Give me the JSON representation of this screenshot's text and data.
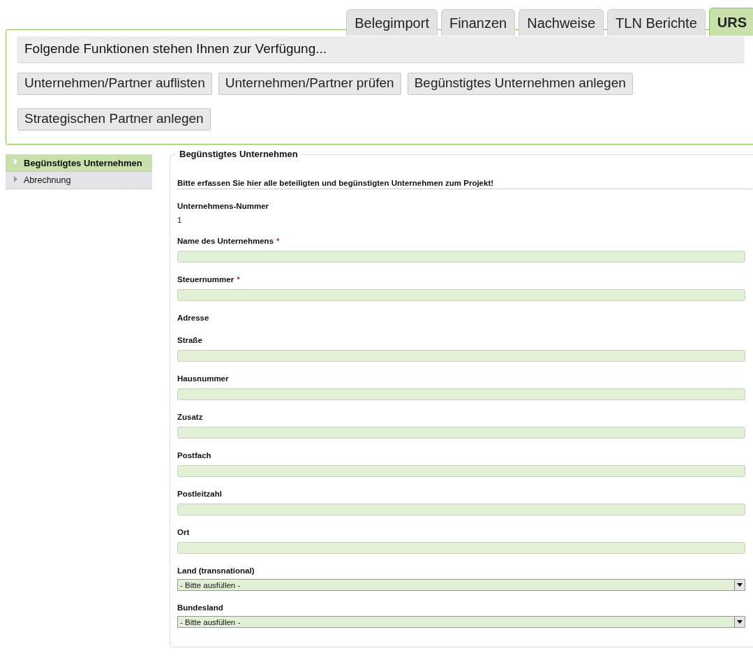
{
  "tabs": [
    {
      "label": "Belegimport",
      "selected": false
    },
    {
      "label": "Finanzen",
      "selected": false
    },
    {
      "label": "Nachweise",
      "selected": false
    },
    {
      "label": "TLN Berichte",
      "selected": false
    },
    {
      "label": "URS",
      "selected": true
    }
  ],
  "functions": {
    "title": "Folgende Funktionen stehen Ihnen zur Verfügung...",
    "buttons": [
      "Unternehmen/Partner auflisten",
      "Unternehmen/Partner prüfen",
      "Begünstigtes Unternehmen anlegen",
      "Strategischen Partner anlegen"
    ]
  },
  "sidebar": {
    "items": [
      {
        "label": "Begünstigtes Unternehmen",
        "selected": true
      },
      {
        "label": "Abrechnung",
        "selected": false
      }
    ]
  },
  "form": {
    "legend": "Begünstigtes Unternehmen",
    "intro": "Bitte erfassen Sie hier alle beteiligten und begünstigten Unternehmen zum Projekt!",
    "fields": [
      {
        "kind": "static",
        "label": "Unternehmens-Nummer",
        "value": "1"
      },
      {
        "kind": "text",
        "label": "Name des Unternehmens",
        "required_mark": "*"
      },
      {
        "kind": "text",
        "label": "Steuernummer",
        "required_mark": "*"
      },
      {
        "kind": "heading",
        "label": "Adresse"
      },
      {
        "kind": "text",
        "label": "Straße"
      },
      {
        "kind": "text",
        "label": "Hausnummer"
      },
      {
        "kind": "text",
        "label": "Zusatz"
      },
      {
        "kind": "text",
        "label": "Postfach"
      },
      {
        "kind": "text",
        "label": "Postleitzahl"
      },
      {
        "kind": "text",
        "label": "Ort"
      },
      {
        "kind": "select",
        "label": "Land (transnational)",
        "value": "- Bitte ausfüllen -"
      },
      {
        "kind": "select",
        "label": "Bundesland",
        "value": "- Bitte ausfüllen -"
      }
    ]
  }
}
